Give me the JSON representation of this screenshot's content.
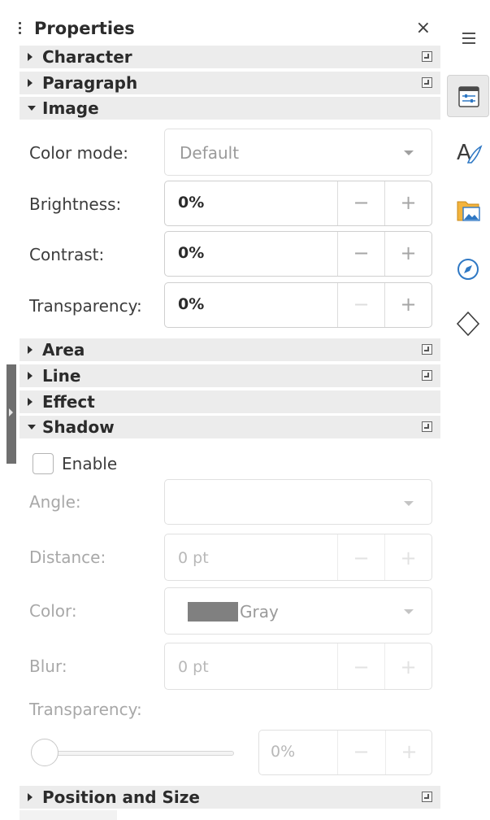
{
  "panel": {
    "title": "Properties",
    "close": "×"
  },
  "sections": {
    "character": "Character",
    "paragraph": "Paragraph",
    "image": "Image",
    "area": "Area",
    "line": "Line",
    "effect": "Effect",
    "shadow": "Shadow",
    "position_size": "Position and Size"
  },
  "image": {
    "color_mode_label": "Color mode:",
    "color_mode_value": "Default",
    "brightness_label": "Brightness:",
    "brightness_value": "0%",
    "contrast_label": "Contrast:",
    "contrast_value": "0%",
    "transparency_label": "Transparency:",
    "transparency_value": "0%"
  },
  "shadow": {
    "enable_label": "Enable",
    "enabled": false,
    "angle_label": "Angle:",
    "angle_value": "",
    "distance_label": "Distance:",
    "distance_value": "0 pt",
    "color_label": "Color:",
    "color_value": "Gray",
    "color_swatch": "#808080",
    "blur_label": "Blur:",
    "blur_value": "0 pt",
    "transparency_label": "Transparency:",
    "transparency_value": "0%",
    "transparency_level": 0
  },
  "spin": {
    "minus": "−",
    "plus": "+"
  },
  "sidebar_icons": [
    "menu-icon",
    "properties-icon",
    "styles-icon",
    "gallery-icon",
    "navigator-icon",
    "shapes-icon"
  ]
}
